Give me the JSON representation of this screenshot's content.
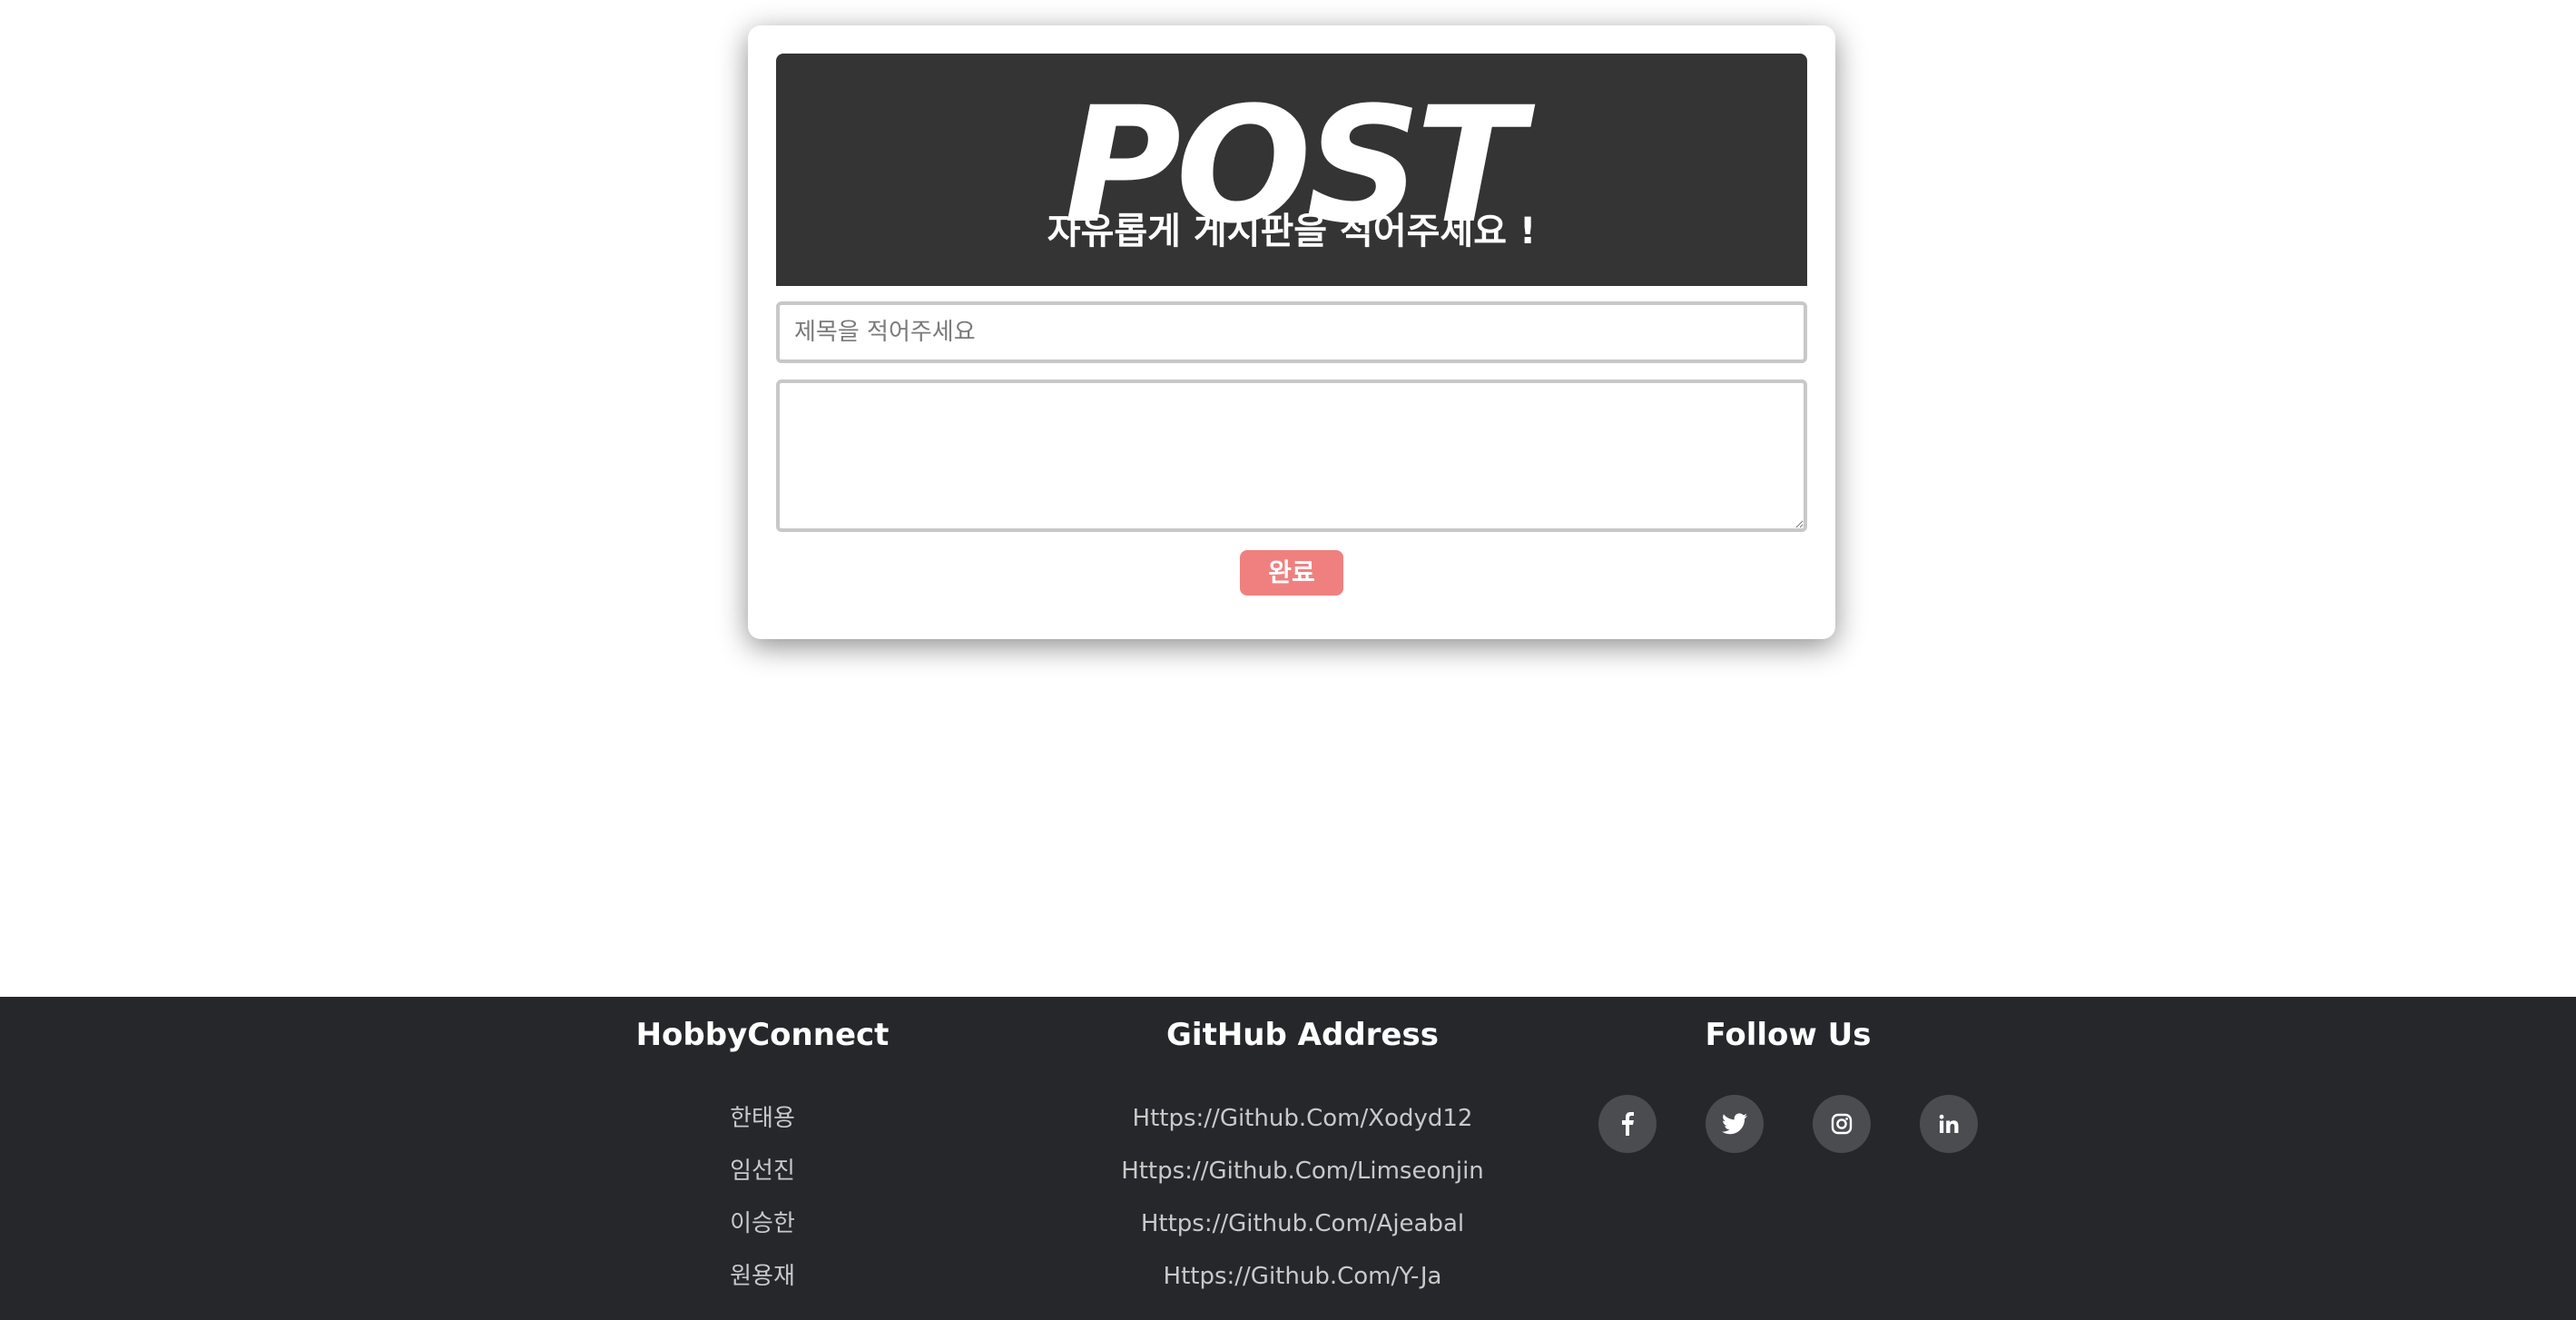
{
  "post_form": {
    "hero_title": "POST",
    "hero_subtitle": "자유롭게 게시판을 적어주세요 !",
    "title_input": {
      "placeholder": "제목을 적어주세요",
      "value": ""
    },
    "body_textarea": {
      "placeholder": "",
      "value": ""
    },
    "submit_label": "완료",
    "colors": {
      "hero_background": "#343434",
      "submit_background": "#f08080",
      "input_border": "#c8c8c8"
    }
  },
  "footer": {
    "background": "#26272b",
    "brand_heading": "HobbyConnect",
    "members": [
      "한태용",
      "임선진",
      "이승한",
      "원용재"
    ],
    "github_heading": "GitHub Address",
    "github_links": [
      "Https://Github.Com/Xodyd12",
      "Https://Github.Com/Limseonjin",
      "Https://Github.Com/Ajeabal",
      "Https://Github.Com/Y-Ja"
    ],
    "follow_heading": "Follow Us",
    "social": [
      {
        "icon": "facebook-icon"
      },
      {
        "icon": "twitter-icon"
      },
      {
        "icon": "instagram-icon"
      },
      {
        "icon": "linkedin-icon"
      }
    ]
  }
}
